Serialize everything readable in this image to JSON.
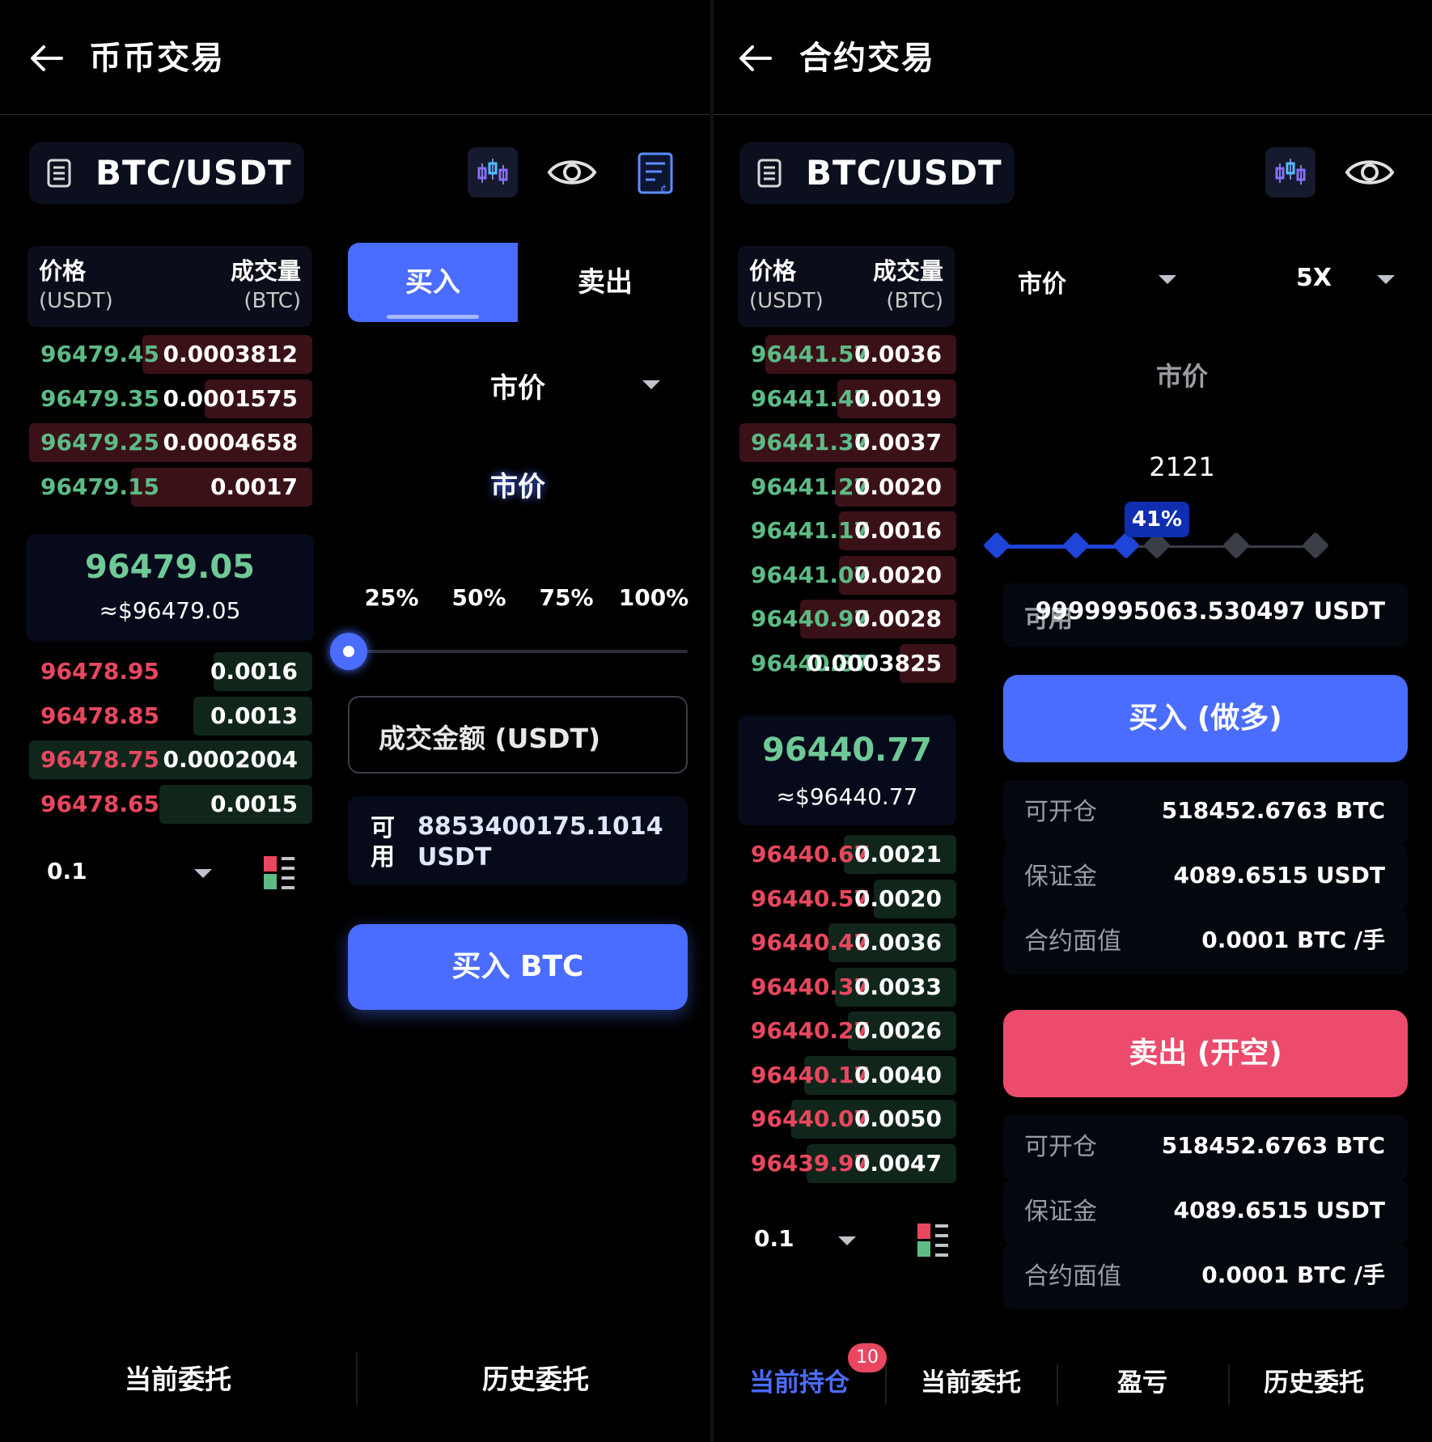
{
  "spot": {
    "title": "币币交易",
    "pair": "BTC/USDT",
    "orderbook": {
      "price_header": "价格",
      "price_unit": "(USDT)",
      "volume_header": "成交量",
      "volume_unit": "(BTC)",
      "asks": [
        {
          "price": "96479.45",
          "qty": "0.0003812",
          "depth": 0.6
        },
        {
          "price": "96479.35",
          "qty": "0.0001575",
          "depth": 0.38
        },
        {
          "price": "96479.25",
          "qty": "0.0004658",
          "depth": 1.0
        },
        {
          "price": "96479.15",
          "qty": "0.0017",
          "depth": 0.64
        }
      ],
      "mid_price": "96479.05",
      "mid_usd": "≈$96479.05",
      "bids": [
        {
          "price": "96478.95",
          "qty": "0.0016",
          "depth": 0.35
        },
        {
          "price": "96478.85",
          "qty": "0.0013",
          "depth": 0.42
        },
        {
          "price": "96478.75",
          "qty": "0.0002004",
          "depth": 1.0
        },
        {
          "price": "96478.65",
          "qty": "0.0015",
          "depth": 0.54
        }
      ],
      "precision": "0.1"
    },
    "buy_tab": "买入",
    "sell_tab": "卖出",
    "order_type": "市价",
    "order_type_display": "市价",
    "percent_labels": [
      "25%",
      "50%",
      "75%",
      "100%"
    ],
    "slider_value": 0,
    "amount_placeholder": "成交金额 (USDT)",
    "available_label": "可用",
    "available_value": "8853400175.1014",
    "available_unit": "USDT",
    "buy_button": "买入 BTC",
    "bottom_tabs": [
      "当前委托",
      "历史委托"
    ]
  },
  "futures": {
    "title": "合约交易",
    "pair": "BTC/USDT",
    "orderbook": {
      "price_header": "价格",
      "price_unit": "(USDT)",
      "volume_header": "成交量",
      "volume_unit": "(BTC)",
      "asks": [
        {
          "price": "96441.57",
          "qty": "0.0036",
          "depth": 0.88
        },
        {
          "price": "96441.47",
          "qty": "0.0019",
          "depth": 0.55
        },
        {
          "price": "96441.37",
          "qty": "0.0037",
          "depth": 1.0
        },
        {
          "price": "96441.27",
          "qty": "0.0020",
          "depth": 0.56
        },
        {
          "price": "96441.17",
          "qty": "0.0016",
          "depth": 0.54
        },
        {
          "price": "96441.07",
          "qty": "0.0020",
          "depth": 0.54
        },
        {
          "price": "96440.97",
          "qty": "0.0028",
          "depth": 0.72
        },
        {
          "price": "96440.87",
          "qty": "0.0003825",
          "depth": 0.26
        }
      ],
      "mid_price": "96440.77",
      "mid_usd": "≈$96440.77",
      "bids": [
        {
          "price": "96440.67",
          "qty": "0.0021",
          "depth": 0.52
        },
        {
          "price": "96440.57",
          "qty": "0.0020",
          "depth": 0.38
        },
        {
          "price": "96440.47",
          "qty": "0.0036",
          "depth": 0.59
        },
        {
          "price": "96440.37",
          "qty": "0.0033",
          "depth": 0.56
        },
        {
          "price": "96440.27",
          "qty": "0.0026",
          "depth": 0.5
        },
        {
          "price": "96440.17",
          "qty": "0.0040",
          "depth": 0.7
        },
        {
          "price": "96440.07",
          "qty": "0.0050",
          "depth": 0.76
        },
        {
          "price": "96439.97",
          "qty": "0.0047",
          "depth": 0.69
        }
      ],
      "precision": "0.1"
    },
    "order_type": "市价",
    "leverage": "5X",
    "price_label": "市价",
    "quantity": "2121",
    "slider_percent": "41%",
    "slider_value": 0.41,
    "available_label": "可用",
    "available_value": "9999995063.530497 USDT",
    "long_button": "买入 (做多)",
    "short_button": "卖出 (开空)",
    "long_info": [
      {
        "label": "可开仓",
        "value": "518452.6763 BTC"
      },
      {
        "label": "保证金",
        "value": "4089.6515 USDT"
      },
      {
        "label": "合约面值",
        "value": "0.0001 BTC /手"
      }
    ],
    "short_info": [
      {
        "label": "可开仓",
        "value": "518452.6763 BTC"
      },
      {
        "label": "保证金",
        "value": "4089.6515 USDT"
      },
      {
        "label": "合约面值",
        "value": "0.0001 BTC /手"
      }
    ],
    "bottom_tabs": [
      {
        "label": "当前持仓",
        "badge": "10"
      },
      {
        "label": "当前委托"
      },
      {
        "label": "盈亏"
      },
      {
        "label": "历史委托"
      }
    ]
  },
  "colors": {
    "accent": "#4a6cff",
    "buy": "#5dbb86",
    "sell": "#e8475f",
    "short_button": "#ec4b6c"
  }
}
